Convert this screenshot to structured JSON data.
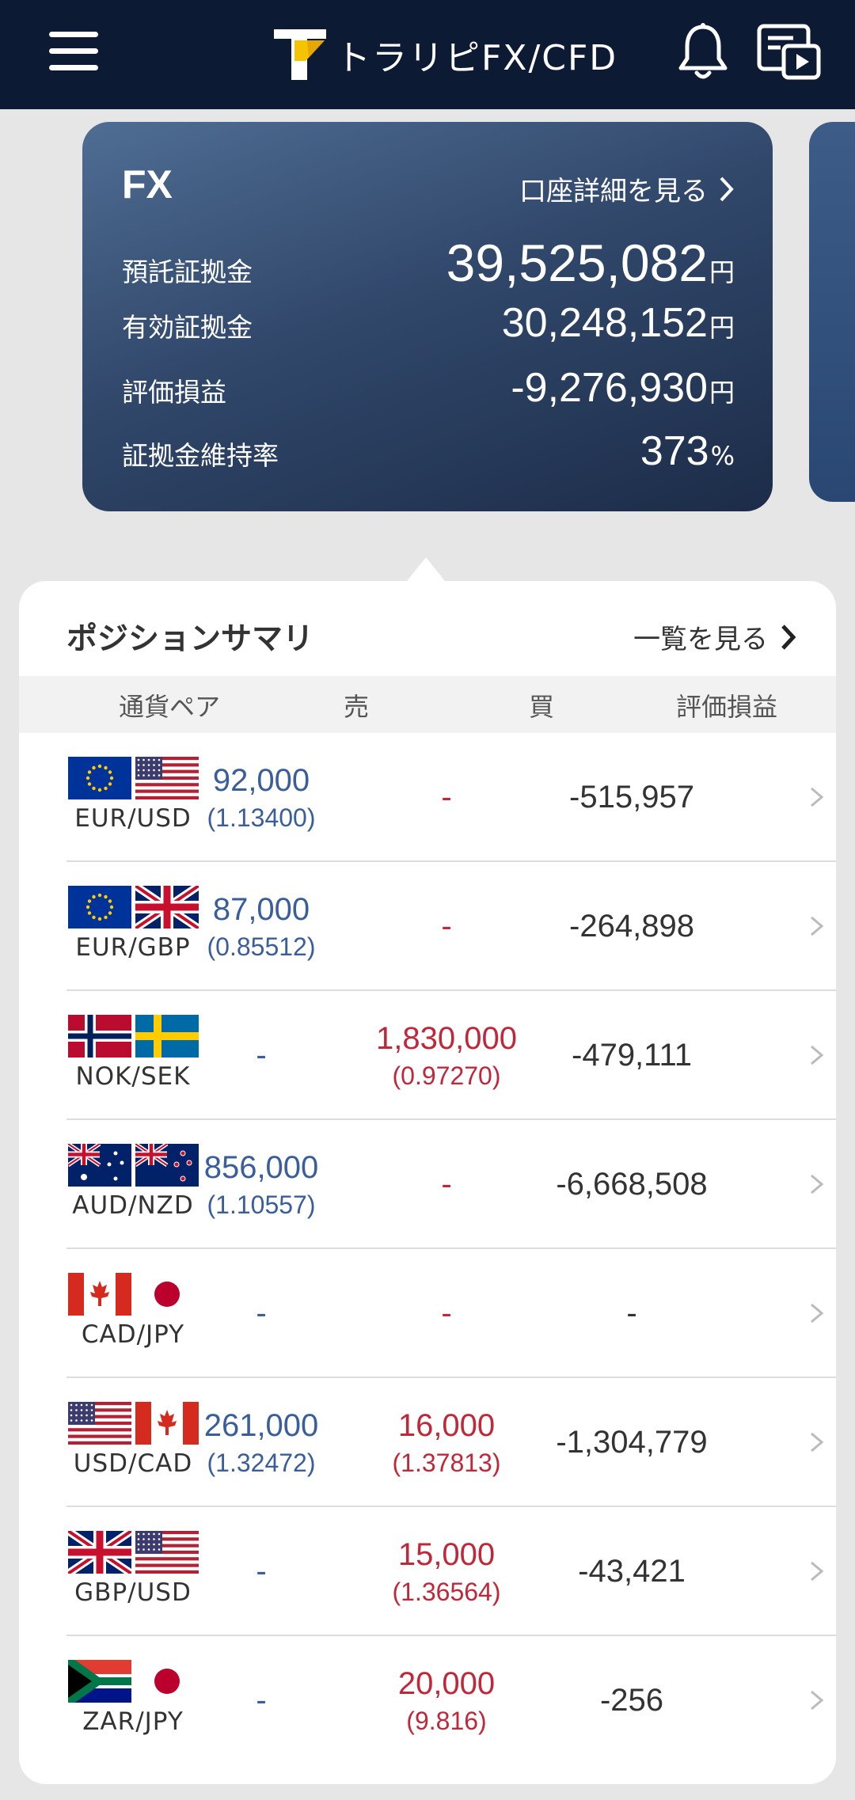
{
  "header": {
    "logo_text": "トラリピFX/CFD",
    "menu_icon": "hamburger-menu-icon",
    "bell_icon": "notification-bell-icon",
    "video_icon": "video-tutorial-icon"
  },
  "fx_card": {
    "title": "FX",
    "detail_link": "口座詳細を見る",
    "rows": [
      {
        "label": "預託証拠金",
        "value": "39,525,082",
        "unit": "円"
      },
      {
        "label": "有効証拠金",
        "value": "30,248,152",
        "unit": "円"
      },
      {
        "label": "評価損益",
        "value": "-9,276,930",
        "unit": "円"
      },
      {
        "label": "証拠金維持率",
        "value": "373",
        "unit": "%"
      }
    ]
  },
  "summary": {
    "title": "ポジションサマリ",
    "view_all": "一覧を見る",
    "columns": [
      "通貨ペア",
      "売",
      "買",
      "評価損益"
    ],
    "rows": [
      {
        "pair": "EUR/USD",
        "flags": [
          "eu",
          "us"
        ],
        "sell": "92,000",
        "sell_rate": "(1.13400)",
        "buy": "-",
        "buy_rate": "",
        "pl": "-515,957"
      },
      {
        "pair": "EUR/GBP",
        "flags": [
          "eu",
          "gb"
        ],
        "sell": "87,000",
        "sell_rate": "(0.85512)",
        "buy": "-",
        "buy_rate": "",
        "pl": "-264,898"
      },
      {
        "pair": "NOK/SEK",
        "flags": [
          "no",
          "se"
        ],
        "sell": "-",
        "sell_rate": "",
        "buy": "1,830,000",
        "buy_rate": "(0.97270)",
        "pl": "-479,111"
      },
      {
        "pair": "AUD/NZD",
        "flags": [
          "au",
          "nz"
        ],
        "sell": "856,000",
        "sell_rate": "(1.10557)",
        "buy": "-",
        "buy_rate": "",
        "pl": "-6,668,508"
      },
      {
        "pair": "CAD/JPY",
        "flags": [
          "ca",
          "jp"
        ],
        "sell": "-",
        "sell_rate": "",
        "buy": "-",
        "buy_rate": "",
        "pl": "-"
      },
      {
        "pair": "USD/CAD",
        "flags": [
          "us",
          "ca"
        ],
        "sell": "261,000",
        "sell_rate": "(1.32472)",
        "buy": "16,000",
        "buy_rate": "(1.37813)",
        "pl": "-1,304,779"
      },
      {
        "pair": "GBP/USD",
        "flags": [
          "gb",
          "us"
        ],
        "sell": "-",
        "sell_rate": "",
        "buy": "15,000",
        "buy_rate": "(1.36564)",
        "pl": "-43,421"
      },
      {
        "pair": "ZAR/JPY",
        "flags": [
          "za",
          "jp"
        ],
        "sell": "-",
        "sell_rate": "",
        "buy": "20,000",
        "buy_rate": "(9.816)",
        "pl": "-256"
      }
    ]
  },
  "colors": {
    "header_bg": "#0d1a33",
    "sell": "#3a5e9c",
    "buy": "#c0283a"
  }
}
